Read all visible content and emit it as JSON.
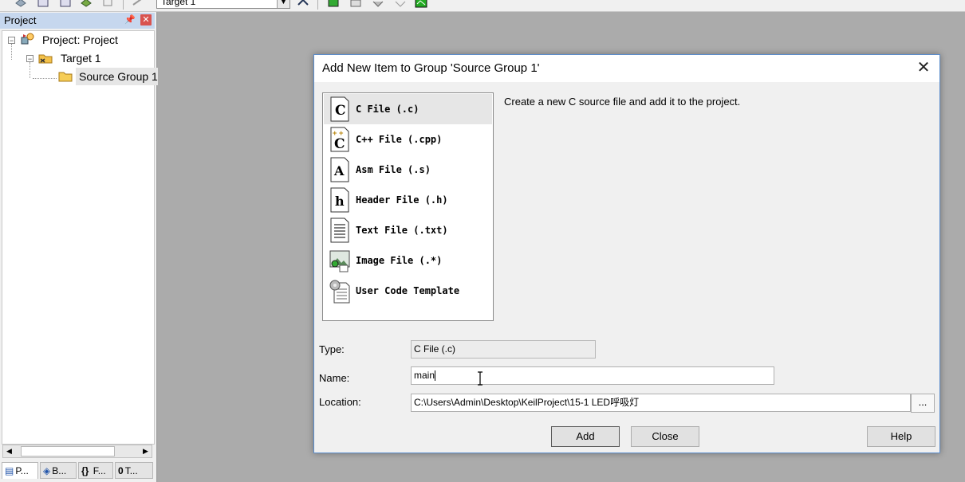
{
  "toolbar": {
    "target_select": "Target 1"
  },
  "project_pane": {
    "title": "Project",
    "tree": {
      "project": "Project: Project",
      "target": "Target 1",
      "group": "Source Group 1"
    },
    "tabs": [
      {
        "label": "P..."
      },
      {
        "label": "B..."
      },
      {
        "label": "F...",
        "prefix": "{}"
      },
      {
        "label": "T...",
        "prefix": "0"
      }
    ]
  },
  "dialog": {
    "title": "Add New Item to Group 'Source Group 1'",
    "close_glyph": "✕",
    "description": "Create a new C source file and add it to the project.",
    "file_types": [
      {
        "label": "C File (.c)",
        "icon": "c-file-icon"
      },
      {
        "label": "C++ File (.cpp)",
        "icon": "cpp-file-icon"
      },
      {
        "label": "Asm File (.s)",
        "icon": "asm-file-icon"
      },
      {
        "label": "Header File (.h)",
        "icon": "header-file-icon"
      },
      {
        "label": "Text File (.txt)",
        "icon": "text-file-icon"
      },
      {
        "label": "Image File (.*)",
        "icon": "image-file-icon"
      },
      {
        "label": "User Code Template",
        "icon": "template-icon"
      }
    ],
    "fields": {
      "type_label": "Type:",
      "type_value": "C File (.c)",
      "name_label": "Name:",
      "name_value": "main",
      "location_label": "Location:",
      "location_value": "C:\\Users\\Admin\\Desktop\\KeilProject\\15-1 LED呼吸灯"
    },
    "browse_label": "...",
    "buttons": {
      "add": "Add",
      "close": "Close",
      "help": "Help"
    }
  },
  "colors": {
    "accent": "#c6d7ee",
    "dialog_border": "#5a8ccc",
    "workspace": "#ababab"
  }
}
